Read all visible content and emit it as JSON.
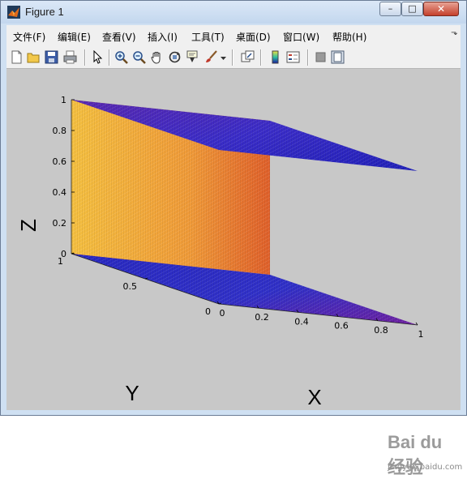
{
  "window": {
    "title": "Figure 1"
  },
  "titlebar_buttons": {
    "minimize": "–",
    "maximize": "□",
    "close": "✕"
  },
  "menus": [
    "文件(F)",
    "编辑(E)",
    "查看(V)",
    "插入(I)",
    "工具(T)",
    "桌面(D)",
    "窗口(W)",
    "帮助(H)"
  ],
  "toolbar_icons": [
    "new-figure-icon",
    "open-file-icon",
    "save-icon",
    "print-icon",
    "edit-plot-arrow-icon",
    "zoom-in-icon",
    "zoom-out-icon",
    "pan-hand-icon",
    "rotate-3d-icon",
    "data-cursor-icon",
    "brush-icon",
    "brush-dropdown-icon",
    "link-plot-icon",
    "colorbar-icon",
    "legend-icon",
    "hide-plot-tools-icon",
    "show-plot-tools-icon"
  ],
  "axes": {
    "xlabel": "X",
    "ylabel": "Y",
    "zlabel": "Z",
    "x_ticks": [
      "0",
      "0.2",
      "0.4",
      "0.6",
      "0.8",
      "1"
    ],
    "y_ticks": [
      "0",
      "0.5",
      "1"
    ],
    "z_ticks": [
      "0",
      "0.2",
      "0.4",
      "0.6",
      "0.8",
      "1"
    ]
  },
  "chart_data": {
    "type": "3d-mesh",
    "title": "",
    "xlabel": "X",
    "ylabel": "Y",
    "zlabel": "Z",
    "xlim": [
      0,
      1
    ],
    "ylim": [
      0,
      1
    ],
    "zlim": [
      0,
      1
    ],
    "x_ticks": [
      0,
      0.2,
      0.4,
      0.6,
      0.8,
      1
    ],
    "y_ticks": [
      0,
      0.5,
      1
    ],
    "z_ticks": [
      0,
      0.2,
      0.4,
      0.6,
      0.8,
      1
    ],
    "faces": [
      {
        "name": "bottom",
        "colormap": "z",
        "value_at_z": 0
      },
      {
        "name": "top",
        "colormap": "z",
        "value_at_z": 1
      },
      {
        "name": "side-x0",
        "colormap": "x"
      },
      {
        "name": "side-y1",
        "colormap": "y"
      }
    ],
    "colors": {
      "low": "#1a1aa0",
      "mid": "#e0303a",
      "high": "#ffd040",
      "background": "#c8c8c8"
    }
  },
  "watermark": {
    "text": "Bai du 经验",
    "url": "jingyan.baidu.com"
  }
}
